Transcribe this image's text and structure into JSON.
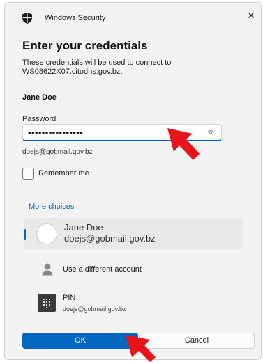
{
  "window": {
    "app_title": "Windows Security",
    "close_glyph": "✕"
  },
  "dialog": {
    "heading": "Enter your credentials",
    "description_line1": "These credentials will be used to connect to",
    "description_line2": "WS08622X07.citodns.gov.bz.",
    "user_name": "Jane Doe"
  },
  "password": {
    "label": "Password",
    "masked_value": "••••••••••••••••",
    "reveal_icon": "eye-icon"
  },
  "account_hint": "doejs@gobmail.gov.bz",
  "remember": {
    "label": "Remember me",
    "checked": false
  },
  "more_choices": {
    "label": "More choices",
    "items": [
      {
        "name": "Jane Doe",
        "email": "doejs@gobmail.gov.bz",
        "icon": "avatar",
        "selected": true
      },
      {
        "label": "Use a different account",
        "icon": "person-icon"
      },
      {
        "title": "PIN",
        "subtitle": "doejs@gobmail.gov.bz",
        "icon": "keypad-icon"
      }
    ]
  },
  "buttons": {
    "ok": "OK",
    "cancel": "Cancel"
  },
  "colors": {
    "accent": "#0067c0",
    "annotation_arrow": "#e8141b",
    "background": "#f3f3f3"
  }
}
